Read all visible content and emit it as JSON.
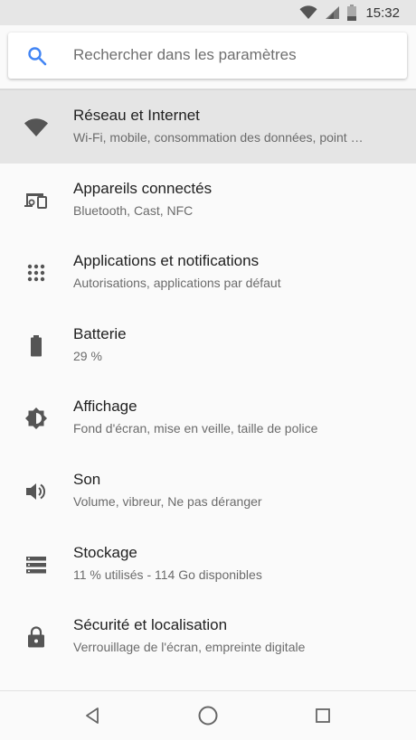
{
  "status_bar": {
    "time": "15:32",
    "icons": [
      "wifi-icon",
      "signal-icon",
      "battery-icon"
    ]
  },
  "search": {
    "placeholder": "Rechercher dans les paramètres",
    "icon": "search-icon",
    "accent_color": "#4285f4"
  },
  "settings": {
    "items": [
      {
        "icon": "wifi-icon",
        "title": "Réseau et Internet",
        "subtitle": "Wi-Fi, mobile, consommation des données, point …",
        "selected": true
      },
      {
        "icon": "connected-devices-icon",
        "title": "Appareils connectés",
        "subtitle": "Bluetooth, Cast, NFC"
      },
      {
        "icon": "apps-icon",
        "title": "Applications et notifications",
        "subtitle": "Autorisations, applications par défaut"
      },
      {
        "icon": "battery-icon",
        "title": "Batterie",
        "subtitle": "29 %"
      },
      {
        "icon": "brightness-icon",
        "title": "Affichage",
        "subtitle": "Fond d'écran, mise en veille, taille de police"
      },
      {
        "icon": "volume-icon",
        "title": "Son",
        "subtitle": "Volume, vibreur, Ne pas déranger"
      },
      {
        "icon": "storage-icon",
        "title": "Stockage",
        "subtitle": "11 % utilisés - 114 Go disponibles"
      },
      {
        "icon": "lock-icon",
        "title": "Sécurité et localisation",
        "subtitle": "Verrouillage de l'écran, empreinte digitale"
      }
    ]
  },
  "nav_bar": {
    "buttons": [
      "back-icon",
      "home-icon",
      "recents-icon"
    ]
  },
  "colors": {
    "icon_gray": "#5f6368",
    "selected_row": "#e5e5e5",
    "background": "#fafafa"
  }
}
